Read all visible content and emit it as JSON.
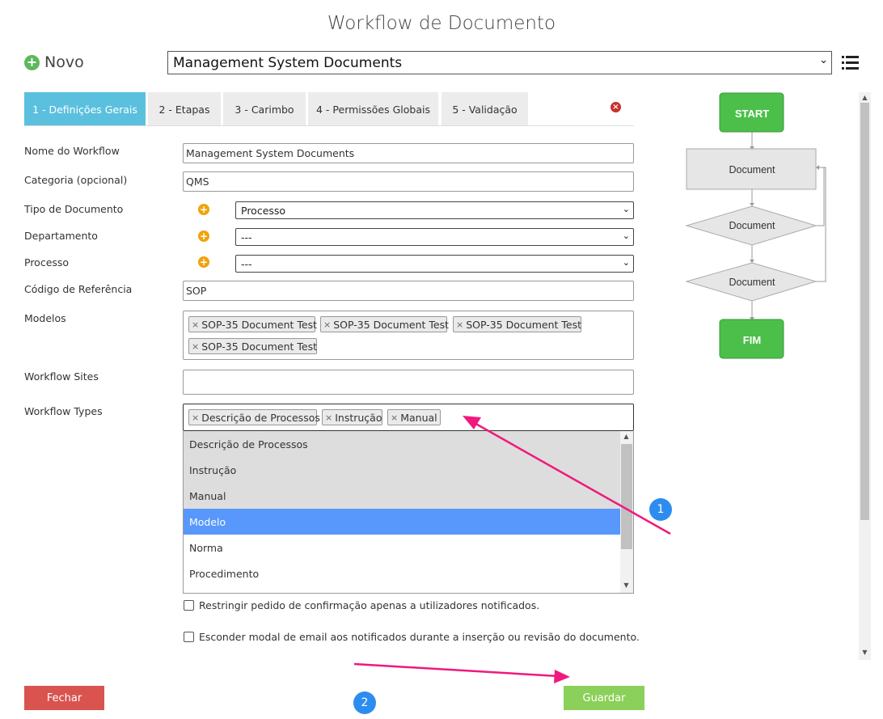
{
  "header": {
    "title": "Workflow de Documento"
  },
  "toolbar": {
    "new_label": "Novo",
    "workflow_selected": "Management System Documents"
  },
  "tabs": [
    {
      "label": "1 - Definições Gerais",
      "active": true
    },
    {
      "label": "2 - Etapas",
      "active": false
    },
    {
      "label": "3 - Carimbo",
      "active": false
    },
    {
      "label": "4 - Permissões Globais",
      "active": false
    },
    {
      "label": "5 - Validação",
      "active": false
    }
  ],
  "form": {
    "name_label": "Nome do Workflow",
    "name_value": "Management System Documents",
    "category_label": "Categoria (opcional)",
    "category_value": "QMS",
    "doctype_label": "Tipo de Documento",
    "doctype_value": "Processo",
    "department_label": "Departamento",
    "department_value": "---",
    "process_label": "Processo",
    "process_value": "---",
    "refcode_label": "Código de Referência",
    "refcode_value": "SOP",
    "models_label": "Modelos",
    "models_tags": [
      "SOP-35 Document Test",
      "SOP-35 Document Test",
      "SOP-35 Document Test",
      "SOP-35 Document Test"
    ],
    "sites_label": "Workflow Sites",
    "sites_value": "",
    "types_label": "Workflow Types",
    "types_tags": [
      "Descrição de Processos",
      "Instrução",
      "Manual"
    ],
    "types_options": [
      {
        "label": "Descrição de Processos",
        "state": "selected"
      },
      {
        "label": "Instrução",
        "state": "selected"
      },
      {
        "label": "Manual",
        "state": "selected"
      },
      {
        "label": "Modelo",
        "state": "highlighted"
      },
      {
        "label": "Norma",
        "state": "normal"
      },
      {
        "label": "Procedimento",
        "state": "normal"
      }
    ],
    "tag_remove_glyph": "×",
    "checkbox1_label": "Restringir pedido de confirmação apenas a utilizadores notificados.",
    "checkbox1_checked": false,
    "checkbox2_label": "Esconder modal de email aos notificados durante a inserção ou revisão do documento.",
    "checkbox2_checked": false
  },
  "diagram": {
    "start": "START",
    "step1": "Document",
    "decision1": "Document",
    "decision2": "Document",
    "end": "FIM"
  },
  "footer": {
    "close_label": "Fechar",
    "save_label": "Guardar"
  },
  "annotations": {
    "badge1": "1",
    "badge2": "2"
  },
  "colors": {
    "tab_active": "#5bc0de",
    "highlight": "#5897fb",
    "close_button": "#d9534f",
    "save_button": "#8bd05a",
    "node_green": "#4cbf4a",
    "arrow_pink": "#f0197d",
    "badge_blue": "#2d8cf0"
  }
}
